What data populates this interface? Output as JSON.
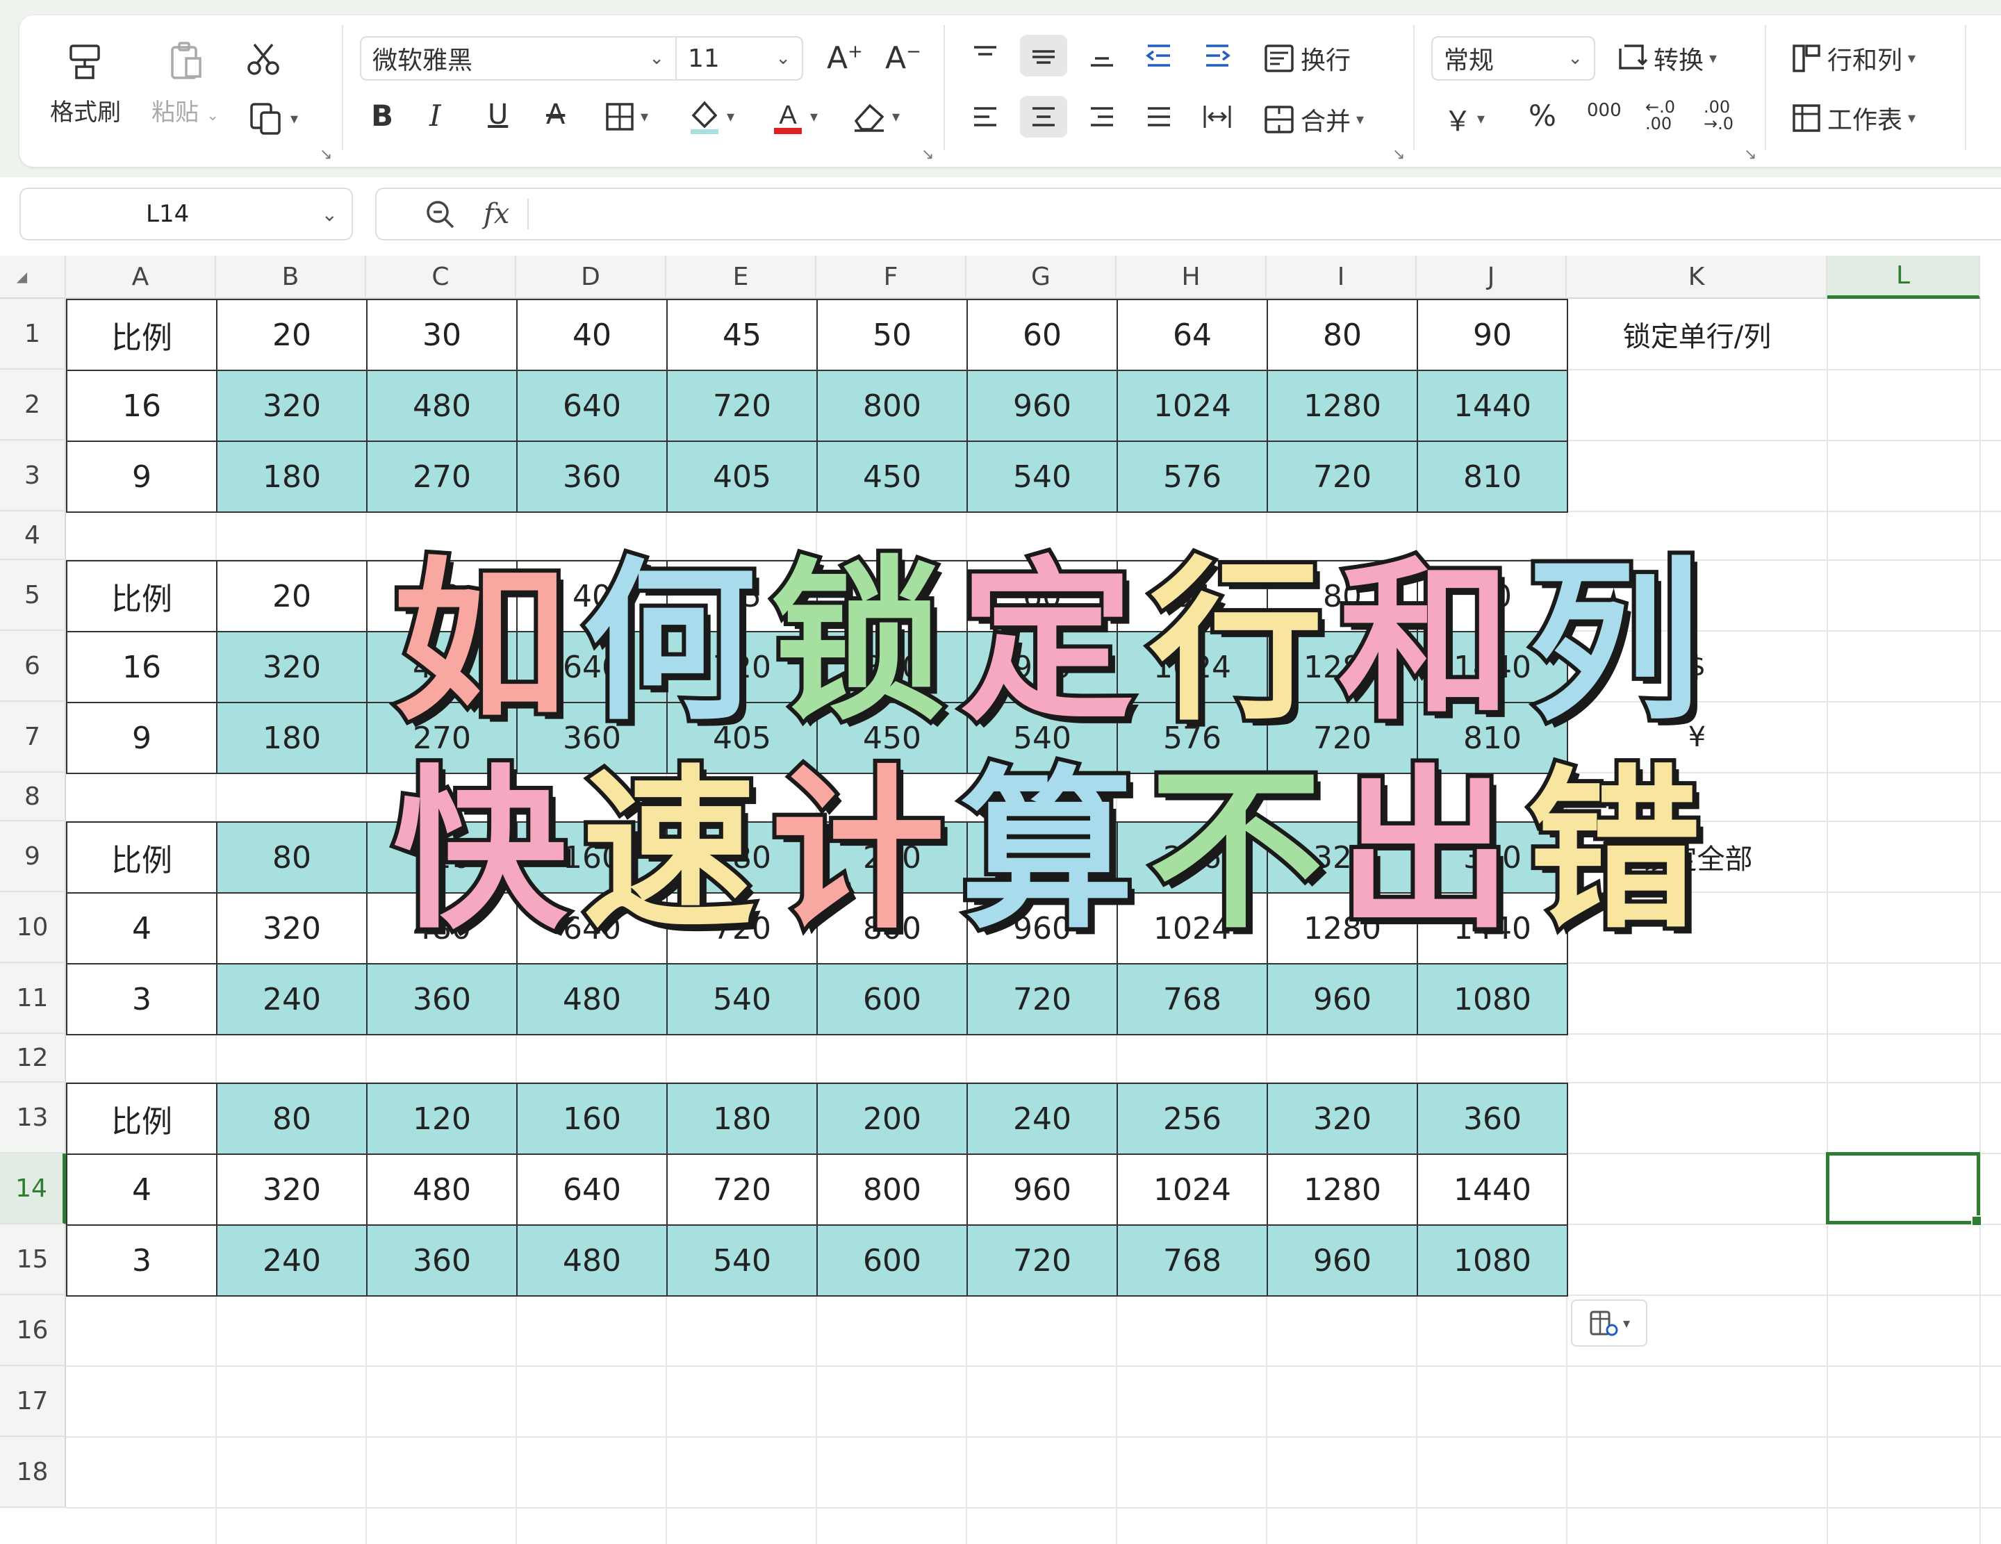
{
  "ribbon": {
    "format_painter": "格式刷",
    "paste": "粘贴",
    "font_name": "微软雅黑",
    "font_size": "11",
    "wrap_text": "换行",
    "merge": "合并",
    "number_format": "常规",
    "convert": "转换",
    "rows_cols": "行和列",
    "worksheet": "工作表",
    "percent": "%",
    "thousands": "000",
    "currency": "￥"
  },
  "formula_bar": {
    "name_box": "L14",
    "fx": "fx",
    "content": ""
  },
  "columns": [
    "A",
    "B",
    "C",
    "D",
    "E",
    "F",
    "G",
    "H",
    "I",
    "J",
    "K",
    "L"
  ],
  "rows": [
    "1",
    "2",
    "3",
    "4",
    "5",
    "6",
    "7",
    "8",
    "9",
    "10",
    "11",
    "12",
    "13",
    "14",
    "15",
    "16",
    "17",
    "18"
  ],
  "active_cell": "L14",
  "tables": [
    {
      "row_start": 1,
      "rows": [
        [
          "比例",
          "20",
          "30",
          "40",
          "45",
          "50",
          "60",
          "64",
          "80",
          "90"
        ],
        [
          "16",
          "320",
          "480",
          "640",
          "720",
          "800",
          "960",
          "1024",
          "1280",
          "1440"
        ],
        [
          "9",
          "180",
          "270",
          "360",
          "405",
          "450",
          "540",
          "576",
          "720",
          "810"
        ]
      ]
    },
    {
      "row_start": 5,
      "rows": [
        [
          "比例",
          "20",
          "30",
          "40",
          "45",
          "50",
          "60",
          "64",
          "80",
          "90"
        ],
        [
          "16",
          "320",
          "480",
          "640",
          "720",
          "800",
          "960",
          "1024",
          "1280",
          "1440"
        ],
        [
          "9",
          "180",
          "270",
          "360",
          "405",
          "450",
          "540",
          "576",
          "720",
          "810"
        ]
      ]
    },
    {
      "row_start": 9,
      "rows": [
        [
          "比例",
          "80",
          "120",
          "160",
          "180",
          "200",
          "240",
          "256",
          "320",
          "360"
        ],
        [
          "4",
          "320",
          "480",
          "640",
          "720",
          "800",
          "960",
          "1024",
          "1280",
          "1440"
        ],
        [
          "3",
          "240",
          "360",
          "480",
          "540",
          "600",
          "720",
          "768",
          "960",
          "1080"
        ]
      ]
    },
    {
      "row_start": 13,
      "rows": [
        [
          "比例",
          "80",
          "120",
          "160",
          "180",
          "200",
          "240",
          "256",
          "320",
          "360"
        ],
        [
          "4",
          "320",
          "480",
          "640",
          "720",
          "800",
          "960",
          "1024",
          "1280",
          "1440"
        ],
        [
          "3",
          "240",
          "360",
          "480",
          "540",
          "600",
          "720",
          "768",
          "960",
          "1080"
        ]
      ]
    }
  ],
  "k_notes": {
    "k1": "锁定单行/列",
    "k6": "$",
    "k7": "¥",
    "k9": "锁定全部"
  },
  "colors": {
    "teal_fill": "#a8dfdf",
    "active_border": "#2e7d32",
    "selected_header": "#e2ece2"
  },
  "overlay": {
    "line1": [
      "如",
      "何",
      "锁",
      "定",
      "行",
      "和",
      "列"
    ],
    "line2": [
      "快",
      "速",
      "计",
      "算",
      "不",
      "出",
      "错"
    ],
    "line1_colors": [
      "#f8a8a0",
      "#a8dcec",
      "#a6e0a0",
      "#f6a8c0",
      "#f8e6a0",
      "#f6a8c0",
      "#a8dcec"
    ],
    "line2_colors": [
      "#f6a8c0",
      "#f8e6a0",
      "#f8a8a0",
      "#a8dcec",
      "#a6e0a0",
      "#f6a8c0",
      "#f8e6a0"
    ]
  }
}
